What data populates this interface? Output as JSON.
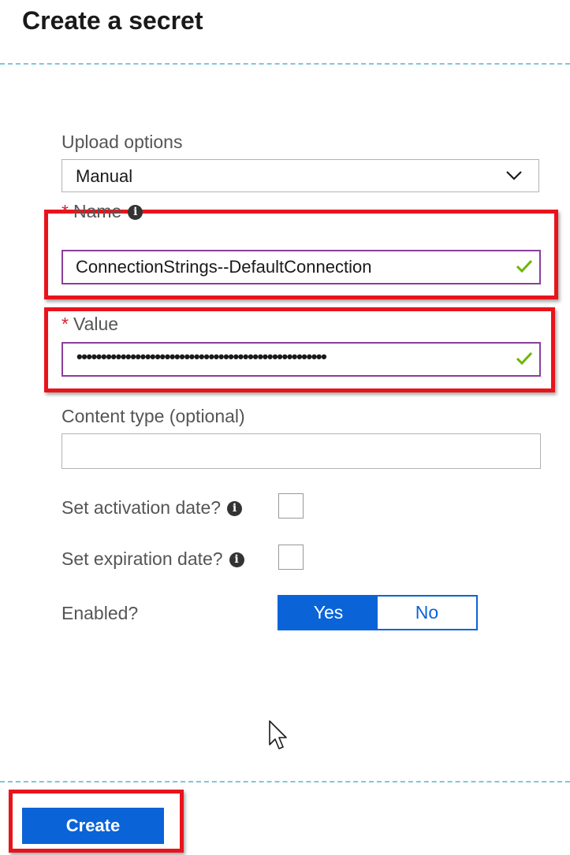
{
  "panel": {
    "title": "Create a secret"
  },
  "form": {
    "upload_options": {
      "label": "Upload options",
      "value": "Manual"
    },
    "name": {
      "required_marker": "*",
      "label": "Name",
      "value": "ConnectionStrings--DefaultConnection"
    },
    "value": {
      "required_marker": "*",
      "label": "Value",
      "masked_value": "•••••••••••••••••••••••••••••••••••••••••••••••••••"
    },
    "content_type": {
      "label": "Content type (optional)",
      "value": ""
    },
    "activation_date": {
      "label": "Set activation date?",
      "checked": false
    },
    "expiration_date": {
      "label": "Set expiration date?",
      "checked": false
    },
    "enabled": {
      "label": "Enabled?",
      "options": [
        "Yes",
        "No"
      ],
      "selected": "Yes"
    }
  },
  "footer": {
    "create_label": "Create"
  },
  "icons": {
    "info": "info-icon",
    "chevron": "chevron-down-icon",
    "check": "checkmark-icon",
    "cursor": "mouse-cursor-icon"
  },
  "colors": {
    "accent": "#0a64d8",
    "valid_border": "#8b3d9c",
    "valid_check": "#6bb700",
    "required": "#d6242b",
    "highlight": "#e8141c",
    "divider": "#7fc7d9"
  }
}
